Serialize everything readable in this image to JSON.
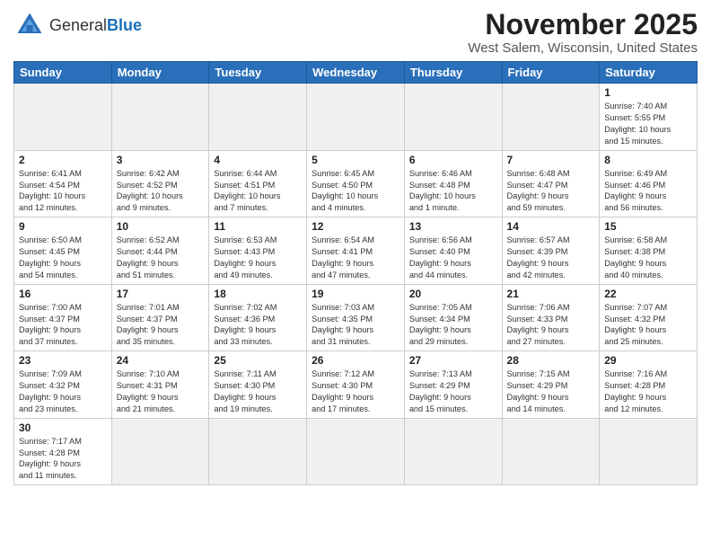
{
  "header": {
    "logo_general": "General",
    "logo_blue": "Blue",
    "month_title": "November 2025",
    "location": "West Salem, Wisconsin, United States"
  },
  "weekdays": [
    "Sunday",
    "Monday",
    "Tuesday",
    "Wednesday",
    "Thursday",
    "Friday",
    "Saturday"
  ],
  "weeks": [
    [
      {
        "day": "",
        "info": ""
      },
      {
        "day": "",
        "info": ""
      },
      {
        "day": "",
        "info": ""
      },
      {
        "day": "",
        "info": ""
      },
      {
        "day": "",
        "info": ""
      },
      {
        "day": "",
        "info": ""
      },
      {
        "day": "1",
        "info": "Sunrise: 7:40 AM\nSunset: 5:55 PM\nDaylight: 10 hours\nand 15 minutes."
      }
    ],
    [
      {
        "day": "2",
        "info": "Sunrise: 6:41 AM\nSunset: 4:54 PM\nDaylight: 10 hours\nand 12 minutes."
      },
      {
        "day": "3",
        "info": "Sunrise: 6:42 AM\nSunset: 4:52 PM\nDaylight: 10 hours\nand 9 minutes."
      },
      {
        "day": "4",
        "info": "Sunrise: 6:44 AM\nSunset: 4:51 PM\nDaylight: 10 hours\nand 7 minutes."
      },
      {
        "day": "5",
        "info": "Sunrise: 6:45 AM\nSunset: 4:50 PM\nDaylight: 10 hours\nand 4 minutes."
      },
      {
        "day": "6",
        "info": "Sunrise: 6:46 AM\nSunset: 4:48 PM\nDaylight: 10 hours\nand 1 minute."
      },
      {
        "day": "7",
        "info": "Sunrise: 6:48 AM\nSunset: 4:47 PM\nDaylight: 9 hours\nand 59 minutes."
      },
      {
        "day": "8",
        "info": "Sunrise: 6:49 AM\nSunset: 4:46 PM\nDaylight: 9 hours\nand 56 minutes."
      }
    ],
    [
      {
        "day": "9",
        "info": "Sunrise: 6:50 AM\nSunset: 4:45 PM\nDaylight: 9 hours\nand 54 minutes."
      },
      {
        "day": "10",
        "info": "Sunrise: 6:52 AM\nSunset: 4:44 PM\nDaylight: 9 hours\nand 51 minutes."
      },
      {
        "day": "11",
        "info": "Sunrise: 6:53 AM\nSunset: 4:43 PM\nDaylight: 9 hours\nand 49 minutes."
      },
      {
        "day": "12",
        "info": "Sunrise: 6:54 AM\nSunset: 4:41 PM\nDaylight: 9 hours\nand 47 minutes."
      },
      {
        "day": "13",
        "info": "Sunrise: 6:56 AM\nSunset: 4:40 PM\nDaylight: 9 hours\nand 44 minutes."
      },
      {
        "day": "14",
        "info": "Sunrise: 6:57 AM\nSunset: 4:39 PM\nDaylight: 9 hours\nand 42 minutes."
      },
      {
        "day": "15",
        "info": "Sunrise: 6:58 AM\nSunset: 4:38 PM\nDaylight: 9 hours\nand 40 minutes."
      }
    ],
    [
      {
        "day": "16",
        "info": "Sunrise: 7:00 AM\nSunset: 4:37 PM\nDaylight: 9 hours\nand 37 minutes."
      },
      {
        "day": "17",
        "info": "Sunrise: 7:01 AM\nSunset: 4:37 PM\nDaylight: 9 hours\nand 35 minutes."
      },
      {
        "day": "18",
        "info": "Sunrise: 7:02 AM\nSunset: 4:36 PM\nDaylight: 9 hours\nand 33 minutes."
      },
      {
        "day": "19",
        "info": "Sunrise: 7:03 AM\nSunset: 4:35 PM\nDaylight: 9 hours\nand 31 minutes."
      },
      {
        "day": "20",
        "info": "Sunrise: 7:05 AM\nSunset: 4:34 PM\nDaylight: 9 hours\nand 29 minutes."
      },
      {
        "day": "21",
        "info": "Sunrise: 7:06 AM\nSunset: 4:33 PM\nDaylight: 9 hours\nand 27 minutes."
      },
      {
        "day": "22",
        "info": "Sunrise: 7:07 AM\nSunset: 4:32 PM\nDaylight: 9 hours\nand 25 minutes."
      }
    ],
    [
      {
        "day": "23",
        "info": "Sunrise: 7:09 AM\nSunset: 4:32 PM\nDaylight: 9 hours\nand 23 minutes."
      },
      {
        "day": "24",
        "info": "Sunrise: 7:10 AM\nSunset: 4:31 PM\nDaylight: 9 hours\nand 21 minutes."
      },
      {
        "day": "25",
        "info": "Sunrise: 7:11 AM\nSunset: 4:30 PM\nDaylight: 9 hours\nand 19 minutes."
      },
      {
        "day": "26",
        "info": "Sunrise: 7:12 AM\nSunset: 4:30 PM\nDaylight: 9 hours\nand 17 minutes."
      },
      {
        "day": "27",
        "info": "Sunrise: 7:13 AM\nSunset: 4:29 PM\nDaylight: 9 hours\nand 15 minutes."
      },
      {
        "day": "28",
        "info": "Sunrise: 7:15 AM\nSunset: 4:29 PM\nDaylight: 9 hours\nand 14 minutes."
      },
      {
        "day": "29",
        "info": "Sunrise: 7:16 AM\nSunset: 4:28 PM\nDaylight: 9 hours\nand 12 minutes."
      }
    ],
    [
      {
        "day": "30",
        "info": "Sunrise: 7:17 AM\nSunset: 4:28 PM\nDaylight: 9 hours\nand 11 minutes."
      },
      {
        "day": "",
        "info": ""
      },
      {
        "day": "",
        "info": ""
      },
      {
        "day": "",
        "info": ""
      },
      {
        "day": "",
        "info": ""
      },
      {
        "day": "",
        "info": ""
      },
      {
        "day": "",
        "info": ""
      }
    ]
  ]
}
